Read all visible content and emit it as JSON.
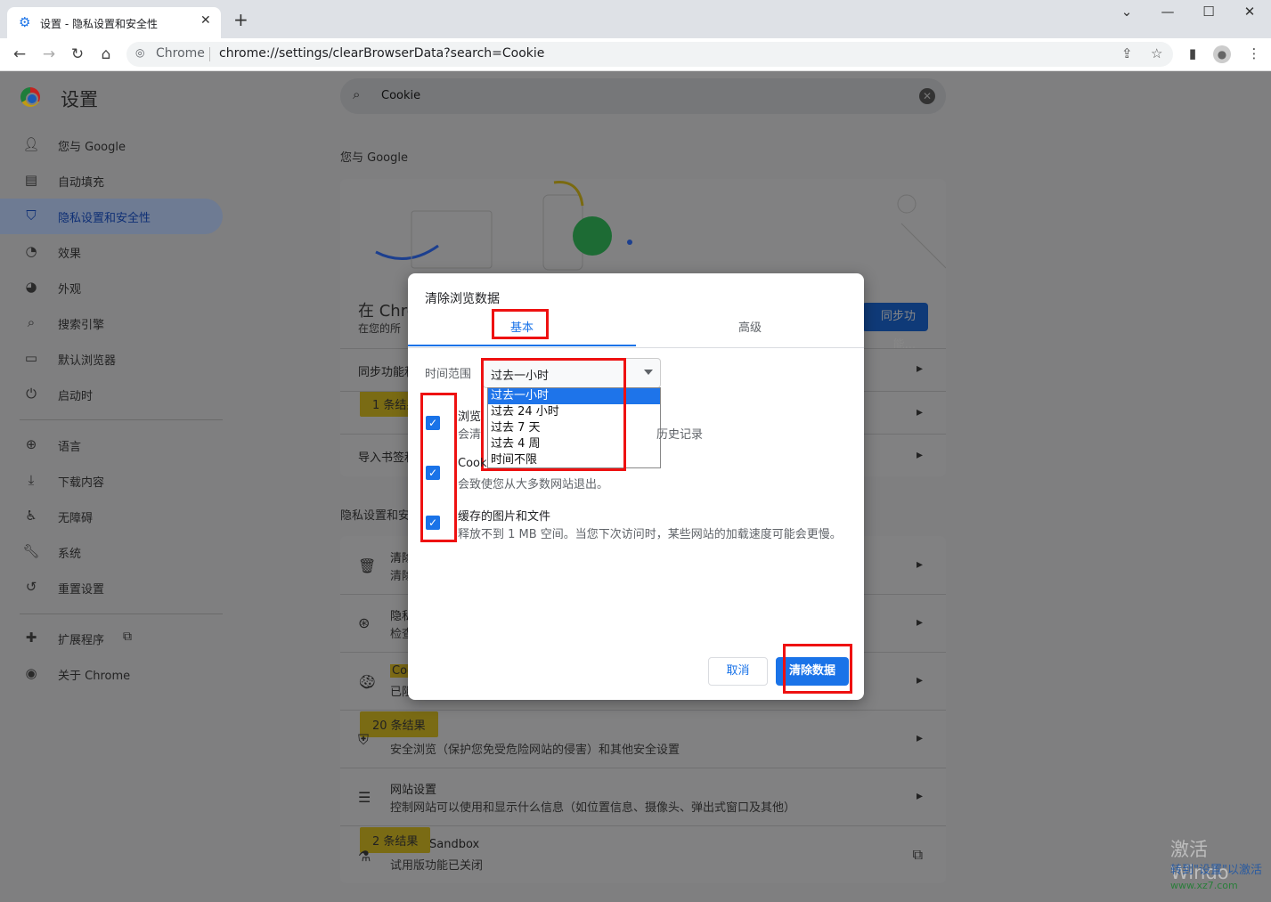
{
  "tab": {
    "title": "设置 - 隐私设置和安全性"
  },
  "omnibox": {
    "chip": "Chrome",
    "url": "chrome://settings/clearBrowserData?search=Cookie"
  },
  "sidebar": {
    "title": "设置",
    "items": [
      {
        "label": "您与 Google",
        "icon": "person-icon"
      },
      {
        "label": "自动填充",
        "icon": "clipboard-icon"
      },
      {
        "label": "隐私设置和安全性",
        "icon": "shield-icon"
      },
      {
        "label": "效果",
        "icon": "gauge-icon"
      },
      {
        "label": "外观",
        "icon": "palette-icon"
      },
      {
        "label": "搜索引擎",
        "icon": "search-icon"
      },
      {
        "label": "默认浏览器",
        "icon": "browser-icon"
      },
      {
        "label": "启动时",
        "icon": "power-icon"
      },
      {
        "label": "语言",
        "icon": "globe-icon"
      },
      {
        "label": "下载内容",
        "icon": "download-icon"
      },
      {
        "label": "无障碍",
        "icon": "accessibility-icon"
      },
      {
        "label": "系统",
        "icon": "wrench-icon"
      },
      {
        "label": "重置设置",
        "icon": "reset-icon"
      },
      {
        "label": "扩展程序",
        "icon": "puzzle-icon"
      },
      {
        "label": "关于 Chrome",
        "icon": "chrome-icon"
      }
    ]
  },
  "search": {
    "value": "Cookie"
  },
  "main": {
    "section_you": "您与 Google",
    "sync_title": "在 Chro",
    "sync_sub": "在您的所",
    "sync_button": "同步功能...",
    "row_sync": "同步功能和",
    "badge_1": "1 条结果",
    "row_import": "导入书签和",
    "section_privacy": "隐私设置和安",
    "privacy_rows": [
      {
        "t": "清除",
        "s": "清除"
      },
      {
        "t": "隐私",
        "s": "检查"
      },
      {
        "t": "Coo",
        "s": "已阻"
      }
    ],
    "badge_20": "20 条结果",
    "safe_browsing_sub": "安全浏览（保护您免受危险网站的侵害）和其他安全设置",
    "site_settings_t": "网站设置",
    "site_settings_s": "控制网站可以使用和显示什么信息（如位置信息、摄像头、弹出式窗口及其他）",
    "badge_2": "2 条结果",
    "sandbox_t": "Sandbox",
    "sandbox_s": "试用版功能已关闭"
  },
  "dialog": {
    "title": "清除浏览数据",
    "tab_basic": "基本",
    "tab_advanced": "高级",
    "range_label": "时间范围",
    "range_value": "过去一小时",
    "range_options": [
      "过去一小时",
      "过去 24 小时",
      "过去 7 天",
      "过去 4 周",
      "时间不限"
    ],
    "items": [
      {
        "title": "浏览",
        "sub": "会清",
        "sub_tail": "历史记录",
        "checked": true
      },
      {
        "title": "Cook",
        "sub": "会致使您从大多数网站退出。",
        "checked": true
      },
      {
        "title": "缓存的图片和文件",
        "sub": "释放不到 1 MB 空间。当您下次访问时，某些网站的加载速度可能会更慢。",
        "checked": true
      }
    ],
    "cancel": "取消",
    "clear": "清除数据"
  },
  "watermark": {
    "line1": "激活 Windo",
    "line2": "转到\"设置\"以激活",
    "line3": "www.xz7.com"
  },
  "colors": {
    "accent": "#1a73e8",
    "highlight": "#ee1111"
  }
}
